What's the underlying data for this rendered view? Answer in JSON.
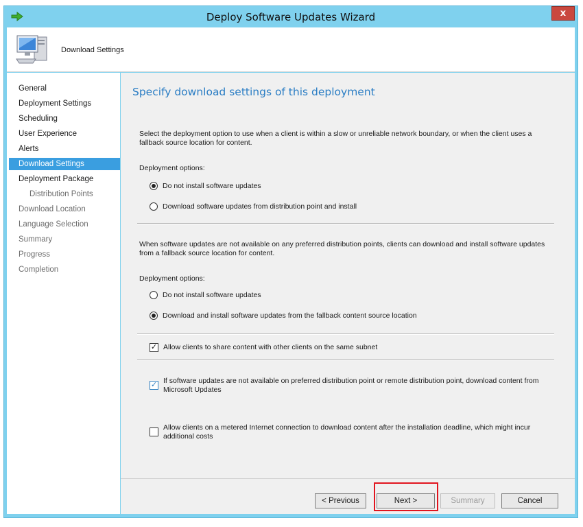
{
  "window": {
    "title": "Deploy Software Updates Wizard",
    "close_label": "x"
  },
  "header": {
    "title": "Download Settings"
  },
  "sidebar": {
    "items": [
      {
        "label": "General"
      },
      {
        "label": "Deployment Settings"
      },
      {
        "label": "Scheduling"
      },
      {
        "label": "User Experience"
      },
      {
        "label": "Alerts"
      },
      {
        "label": "Download Settings"
      },
      {
        "label": "Deployment Package"
      },
      {
        "label": "Distribution Points"
      },
      {
        "label": "Download Location"
      },
      {
        "label": "Language Selection"
      },
      {
        "label": "Summary"
      },
      {
        "label": "Progress"
      },
      {
        "label": "Completion"
      }
    ]
  },
  "main": {
    "heading": "Specify download settings of this deployment",
    "section1": {
      "description": "Select the deployment option to use when a client is within a slow or unreliable network boundary, or when the client uses a fallback source location for content.",
      "options_label": "Deployment options:",
      "options": [
        {
          "label": "Do not install software updates",
          "selected": true
        },
        {
          "label": "Download software updates from distribution point and install",
          "selected": false
        }
      ]
    },
    "section2": {
      "description": "When software updates are not available on any preferred distribution points, clients can download and install software updates from a fallback source location for content.",
      "options_label": "Deployment options:",
      "options": [
        {
          "label": "Do not install software updates",
          "selected": false
        },
        {
          "label": "Download and install software updates from the fallback content source location",
          "selected": true
        }
      ]
    },
    "checkboxes": [
      {
        "label": "Allow clients to share content with other clients on the same subnet",
        "checked": true
      },
      {
        "label": "If software updates are not available on preferred distribution point or remote distribution point, download content from Microsoft Updates",
        "checked": true
      },
      {
        "label": "Allow clients on a metered Internet connection to download content after the installation deadline, which might incur additional costs",
        "checked": false
      }
    ]
  },
  "footer": {
    "previous_label": "< Previous",
    "next_label": "Next >",
    "summary_label": "Summary",
    "cancel_label": "Cancel"
  }
}
